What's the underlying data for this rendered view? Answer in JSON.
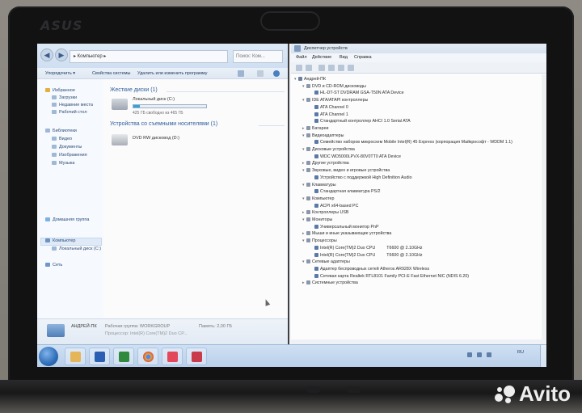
{
  "brand": "ASUS",
  "watermark": "Avito",
  "colors": {
    "accent": "#2f5d9a",
    "disk_fill": "#33a3e0",
    "taskbar": "#c3d7ee"
  },
  "explorer": {
    "address": "▸ Компьютер ▸",
    "search_placeholder": "Поиск: Ком...",
    "toolbar": [
      "Упорядочить ▾",
      "Свойства системы",
      "Удалить или изменить программу"
    ],
    "sidebar": {
      "favorites": "Избранное",
      "favorites_items": [
        "Загрузки",
        "Недавние места",
        "Рабочий стол"
      ],
      "libraries": "Библиотеки",
      "libraries_items": [
        "Видео",
        "Документы",
        "Изображения",
        "Музыка"
      ],
      "homegroup": "Домашняя группа",
      "computer": "Компьютер",
      "computer_items": [
        "Локальный диск (C:)"
      ],
      "network": "Сеть"
    },
    "groups": {
      "hdd": "Жесткие диски (1)",
      "removable": "Устройства со съемными носителями (1)"
    },
    "drive_c": {
      "label": "Локальный диск (C:)",
      "free": "425 ГБ свободно из 465 ГБ",
      "used_fraction": 0.09
    },
    "drive_d": {
      "label": "DVD RW дисковод (D:)"
    },
    "details": {
      "name": "АНДРЕЙ-ПК",
      "workgroup": "Рабочая группа: WORKGROUP",
      "memory": "Память: 2,00 ГБ",
      "cpu": "Процессор: Intel(R) Core(TM)2 Duo CP..."
    }
  },
  "devmgr": {
    "title": "Диспетчер устройств",
    "menu": [
      "Файл",
      "Действие",
      "Вид",
      "Справка"
    ],
    "tree": [
      {
        "level": 0,
        "expanded": "▾",
        "label": "Андрей-ПК"
      },
      {
        "level": 1,
        "expanded": "▾",
        "label": "DVD и CD-ROM дисководы"
      },
      {
        "level": 2,
        "expanded": "",
        "label": "HL-DT-ST DVDRAM GSA-T50N ATA Device"
      },
      {
        "level": 1,
        "expanded": "▾",
        "label": "IDE ATA/ATAPI контроллеры"
      },
      {
        "level": 2,
        "expanded": "",
        "label": "ATA Channel 0"
      },
      {
        "level": 2,
        "expanded": "",
        "label": "ATA Channel 1"
      },
      {
        "level": 2,
        "expanded": "",
        "label": "Стандартный контроллер AHCI 1.0 Serial ATA"
      },
      {
        "level": 1,
        "expanded": "▸",
        "label": "Батареи"
      },
      {
        "level": 1,
        "expanded": "▾",
        "label": "Видеоадаптеры"
      },
      {
        "level": 2,
        "expanded": "",
        "label": "Семейство наборов микросхем Mobile Intel(R) 45 Express (корпорация Майкрософт - WDDM 1.1)"
      },
      {
        "level": 1,
        "expanded": "▾",
        "label": "Дисковые устройства"
      },
      {
        "level": 2,
        "expanded": "",
        "label": "WDC WD5000LPVX-80V0TT0 ATA Device"
      },
      {
        "level": 1,
        "expanded": "▸",
        "label": "Другие устройства"
      },
      {
        "level": 1,
        "expanded": "▾",
        "label": "Звуковые, видео и игровые устройства"
      },
      {
        "level": 2,
        "expanded": "",
        "label": "Устройство с поддержкой High Definition Audio"
      },
      {
        "level": 1,
        "expanded": "▾",
        "label": "Клавиатуры"
      },
      {
        "level": 2,
        "expanded": "",
        "label": "Стандартная клавиатура PS/2"
      },
      {
        "level": 1,
        "expanded": "▾",
        "label": "Компьютер"
      },
      {
        "level": 2,
        "expanded": "",
        "label": "ACPI x64-based PC"
      },
      {
        "level": 1,
        "expanded": "▸",
        "label": "Контроллеры USB"
      },
      {
        "level": 1,
        "expanded": "▾",
        "label": "Мониторы"
      },
      {
        "level": 2,
        "expanded": "",
        "label": "Универсальный монитор PnP"
      },
      {
        "level": 1,
        "expanded": "▸",
        "label": "Мыши и иные указывающие устройства"
      },
      {
        "level": 1,
        "expanded": "▾",
        "label": "Процессоры"
      },
      {
        "level": 2,
        "expanded": "",
        "label": "Intel(R) Core(TM)2 Duo CPU",
        "extra": "T6600  @ 2.10GHz"
      },
      {
        "level": 2,
        "expanded": "",
        "label": "Intel(R) Core(TM)2 Duo CPU",
        "extra": "T6600  @ 2.10GHz"
      },
      {
        "level": 1,
        "expanded": "▾",
        "label": "Сетевые адаптеры"
      },
      {
        "level": 2,
        "expanded": "",
        "label": "Адаптер беспроводных сетей Atheros AR928X Wireless"
      },
      {
        "level": 2,
        "expanded": "",
        "label": "Сетевая карта Realtek RTL8101 Family PCI-E Fast Ethernet NIC (NDIS 6.20)"
      },
      {
        "level": 1,
        "expanded": "▸",
        "label": "Системные устройства"
      }
    ]
  },
  "taskbar": {
    "apps": [
      "explorer",
      "word",
      "excel",
      "chrome",
      "camera",
      "media"
    ],
    "tray_lang": "RU"
  }
}
